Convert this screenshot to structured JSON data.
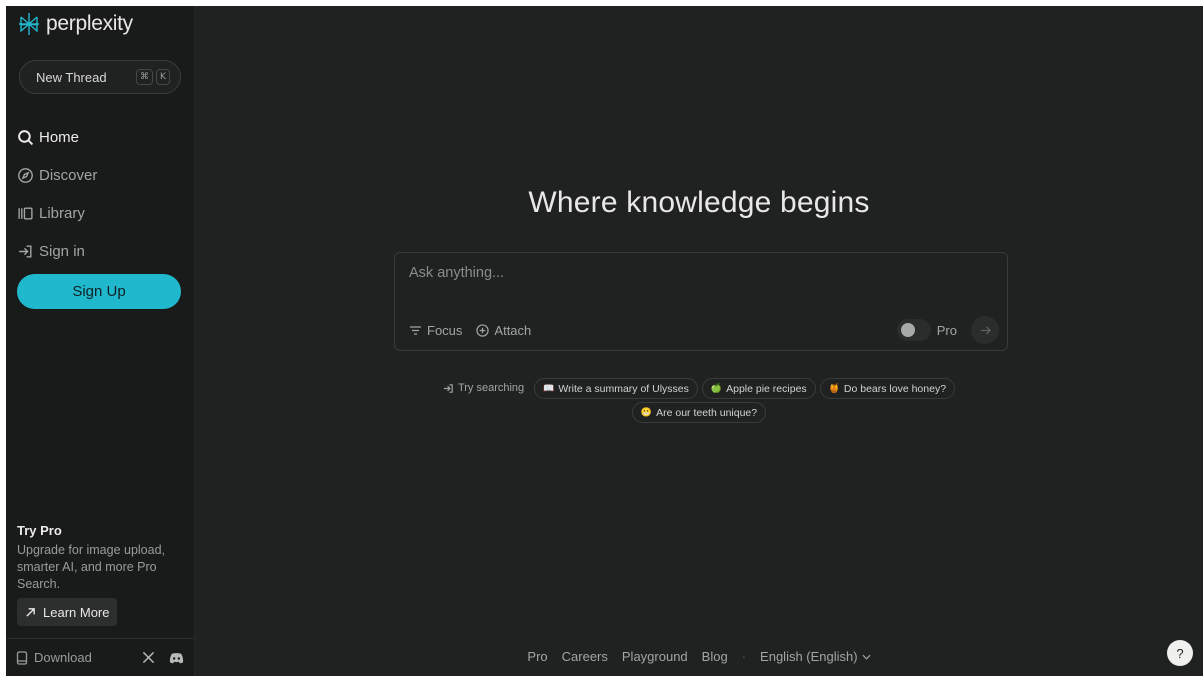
{
  "brand": {
    "name": "perplexity",
    "accent": "#20b8cd"
  },
  "sidebar": {
    "new_thread": {
      "label": "New Thread",
      "shortcut": [
        "⌘",
        "K"
      ]
    },
    "items": [
      {
        "label": "Home",
        "icon": "search-icon",
        "active": true
      },
      {
        "label": "Discover",
        "icon": "compass-icon",
        "active": false
      },
      {
        "label": "Library",
        "icon": "library-icon",
        "active": false
      },
      {
        "label": "Sign in",
        "icon": "sign-in-icon",
        "active": false
      }
    ],
    "signup_label": "Sign Up",
    "try_pro": {
      "title": "Try Pro",
      "description": "Upgrade for image upload, smarter AI, and more Pro Search.",
      "learn_more": "Learn More"
    },
    "footer": {
      "download": "Download",
      "socials": [
        "x-icon",
        "discord-icon"
      ]
    }
  },
  "main": {
    "headline": "Where knowledge begins",
    "search": {
      "placeholder": "Ask anything...",
      "focus_label": "Focus",
      "attach_label": "Attach",
      "pro_label": "Pro",
      "pro_enabled": false
    },
    "suggestions": {
      "label": "Try searching",
      "chips": [
        {
          "emoji": "📖",
          "text": "Write a summary of Ulysses"
        },
        {
          "emoji": "🍏",
          "text": "Apple pie recipes"
        },
        {
          "emoji": "🍯",
          "text": "Do bears love honey?"
        },
        {
          "emoji": "😬",
          "text": "Are our teeth unique?"
        }
      ]
    },
    "footer_links": [
      "Pro",
      "Careers",
      "Playground",
      "Blog"
    ],
    "language": "English (English)",
    "help_label": "?"
  }
}
